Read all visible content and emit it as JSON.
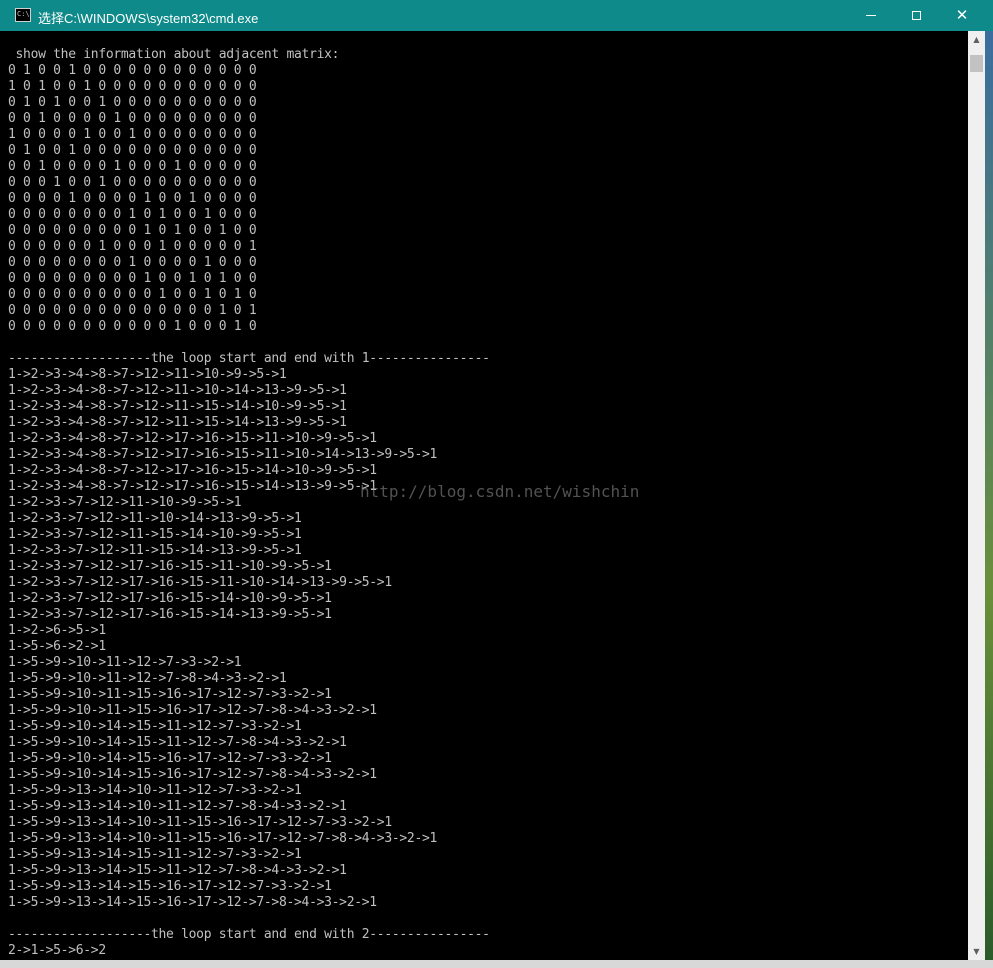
{
  "window": {
    "title": "选择C:\\WINDOWS\\system32\\cmd.exe",
    "icon_text": "C:\\"
  },
  "console": {
    "lines": [
      " show the information about adjacent matrix:",
      "0 1 0 0 1 0 0 0 0 0 0 0 0 0 0 0 0",
      "1 0 1 0 0 1 0 0 0 0 0 0 0 0 0 0 0",
      "0 1 0 1 0 0 1 0 0 0 0 0 0 0 0 0 0",
      "0 0 1 0 0 0 0 1 0 0 0 0 0 0 0 0 0",
      "1 0 0 0 0 1 0 0 1 0 0 0 0 0 0 0 0",
      "0 1 0 0 1 0 0 0 0 0 0 0 0 0 0 0 0",
      "0 0 1 0 0 0 0 1 0 0 0 1 0 0 0 0 0",
      "0 0 0 1 0 0 1 0 0 0 0 0 0 0 0 0 0",
      "0 0 0 0 1 0 0 0 0 1 0 0 1 0 0 0 0",
      "0 0 0 0 0 0 0 0 1 0 1 0 0 1 0 0 0",
      "0 0 0 0 0 0 0 0 0 1 0 1 0 0 1 0 0",
      "0 0 0 0 0 0 1 0 0 0 1 0 0 0 0 0 1",
      "0 0 0 0 0 0 0 0 1 0 0 0 0 1 0 0 0",
      "0 0 0 0 0 0 0 0 0 1 0 0 1 0 1 0 0",
      "0 0 0 0 0 0 0 0 0 0 1 0 0 1 0 1 0",
      "0 0 0 0 0 0 0 0 0 0 0 0 0 0 1 0 1",
      "0 0 0 0 0 0 0 0 0 0 0 1 0 0 0 1 0",
      "",
      "-------------------the loop start and end with 1----------------",
      "1->2->3->4->8->7->12->11->10->9->5->1",
      "1->2->3->4->8->7->12->11->10->14->13->9->5->1",
      "1->2->3->4->8->7->12->11->15->14->10->9->5->1",
      "1->2->3->4->8->7->12->11->15->14->13->9->5->1",
      "1->2->3->4->8->7->12->17->16->15->11->10->9->5->1",
      "1->2->3->4->8->7->12->17->16->15->11->10->14->13->9->5->1",
      "1->2->3->4->8->7->12->17->16->15->14->10->9->5->1",
      "1->2->3->4->8->7->12->17->16->15->14->13->9->5->1",
      "1->2->3->7->12->11->10->9->5->1",
      "1->2->3->7->12->11->10->14->13->9->5->1",
      "1->2->3->7->12->11->15->14->10->9->5->1",
      "1->2->3->7->12->11->15->14->13->9->5->1",
      "1->2->3->7->12->17->16->15->11->10->9->5->1",
      "1->2->3->7->12->17->16->15->11->10->14->13->9->5->1",
      "1->2->3->7->12->17->16->15->14->10->9->5->1",
      "1->2->3->7->12->17->16->15->14->13->9->5->1",
      "1->2->6->5->1",
      "1->5->6->2->1",
      "1->5->9->10->11->12->7->3->2->1",
      "1->5->9->10->11->12->7->8->4->3->2->1",
      "1->5->9->10->11->15->16->17->12->7->3->2->1",
      "1->5->9->10->11->15->16->17->12->7->8->4->3->2->1",
      "1->5->9->10->14->15->11->12->7->3->2->1",
      "1->5->9->10->14->15->11->12->7->8->4->3->2->1",
      "1->5->9->10->14->15->16->17->12->7->3->2->1",
      "1->5->9->10->14->15->16->17->12->7->8->4->3->2->1",
      "1->5->9->13->14->10->11->12->7->3->2->1",
      "1->5->9->13->14->10->11->12->7->8->4->3->2->1",
      "1->5->9->13->14->10->11->15->16->17->12->7->3->2->1",
      "1->5->9->13->14->10->11->15->16->17->12->7->8->4->3->2->1",
      "1->5->9->13->14->15->11->12->7->3->2->1",
      "1->5->9->13->14->15->11->12->7->8->4->3->2->1",
      "1->5->9->13->14->15->16->17->12->7->3->2->1",
      "1->5->9->13->14->15->16->17->12->7->8->4->3->2->1",
      "",
      "-------------------the loop start and end with 2----------------",
      "2->1->5->6->2"
    ],
    "watermark": "http://blog.csdn.net/wishchin"
  },
  "colors": {
    "titlebar": "#0f8a8a",
    "console_bg": "#000000",
    "console_text": "#c0c0c0"
  }
}
